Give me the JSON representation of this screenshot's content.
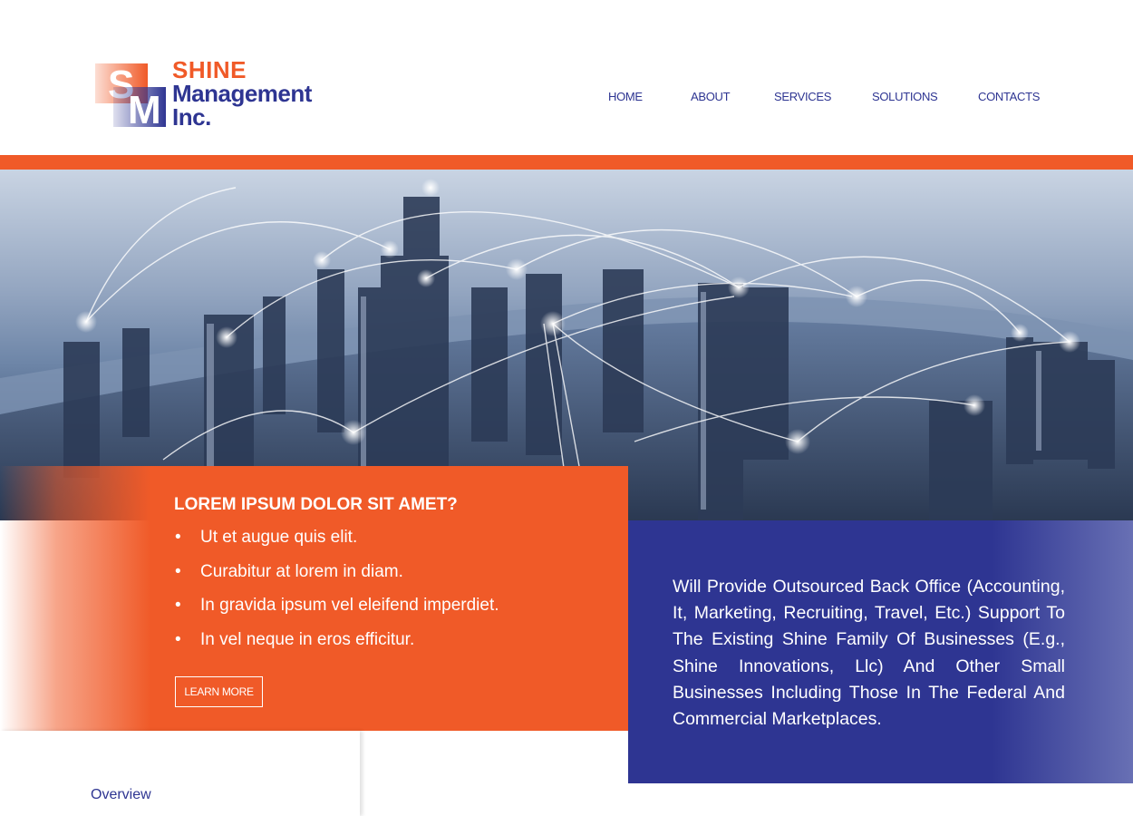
{
  "logo": {
    "line1": "SHINE",
    "line2": "Management",
    "line3": "Inc.",
    "mark_letters": "SM"
  },
  "nav": {
    "items": [
      "HOME",
      "ABOUT",
      "SERVICES",
      "SOLUTIONS",
      "CONTACTS"
    ]
  },
  "hero": {
    "image": "city-network-skyline"
  },
  "promo": {
    "title": "LOREM IPSUM DOLOR SIT AMET?",
    "bullet_char": "•",
    "bullets": [
      "Ut et augue quis elit.",
      "Curabitur at lorem in diam.",
      "In gravida ipsum vel eleifend imperdiet.",
      "In vel neque in eros efficitur."
    ],
    "button_label": "LEARN MORE"
  },
  "info": {
    "text": "Will Provide Outsourced Back Office (Accounting, It, Marketing, Recruiting, Travel, Etc.) Support To The Existing Shine Family Of Businesses (E.g., Shine Innovations, Llc) And Other Small Businesses Including Those In The Federal And Commercial Marketplaces."
  },
  "sidebar": {
    "overview_label": "Overview"
  },
  "colors": {
    "orange": "#f05a28",
    "navy": "#2e3592"
  }
}
